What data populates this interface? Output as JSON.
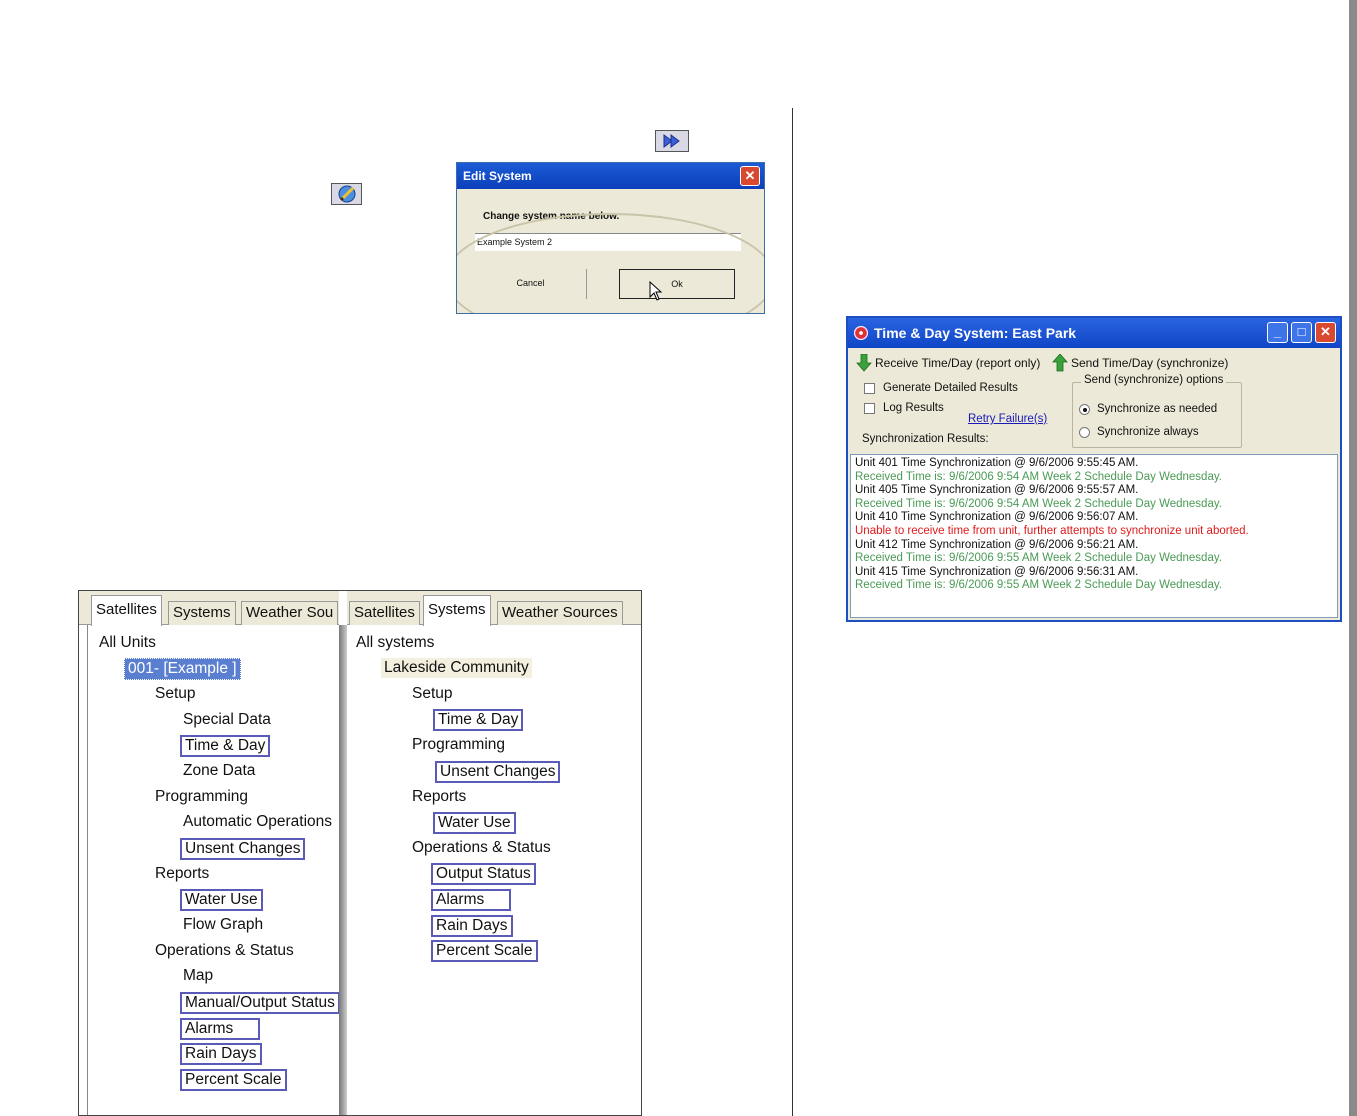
{
  "edit_system": {
    "title": "Edit System",
    "prompt": "Change system name below.",
    "name_value": "Example System 2",
    "cancel_label": "Cancel",
    "ok_label": "Ok"
  },
  "satellites_panel": {
    "tabs": [
      "Satellites",
      "Systems",
      "Weather Sou"
    ],
    "root": "All Units",
    "unit": "001- [Example ]",
    "nodes": [
      "Setup",
      "Special Data",
      "Time & Day",
      "Zone Data",
      "Programming",
      "Automatic Operations",
      "Unsent Changes",
      "Reports",
      "Water Use",
      "Flow Graph",
      "Operations & Status",
      "Map",
      "Manual/Output Status",
      "Alarms",
      "Rain Days",
      "Percent Scale"
    ]
  },
  "systems_panel": {
    "tabs": [
      "Satellites",
      "Systems",
      "Weather Sources"
    ],
    "root": "All systems",
    "system": "Lakeside Community",
    "nodes": [
      "Setup",
      "Time & Day",
      "Programming",
      "Unsent Changes",
      "Reports",
      "Water Use",
      "Operations & Status",
      "Output Status",
      "Alarms",
      "Rain Days",
      "Percent Scale"
    ]
  },
  "time_day": {
    "title": "Time & Day System: East Park",
    "receive_label": "Receive Time/Day  (report only)",
    "send_label": "Send Time/Day (synchronize)",
    "generate_label": "Generate Detailed Results",
    "log_label": "Log Results",
    "retry_label": "Retry Failure(s)",
    "options_legend": "Send (synchronize) options",
    "sync_needed_label": "Synchronize as needed",
    "sync_always_label": "Synchronize always",
    "results_label": "Synchronization Results:",
    "selected_option": "Synchronize as needed",
    "log": [
      "Unit 401 Time Synchronization @ 9/6/2006 9:55:45 AM.",
      "Received Time is: 9/6/2006 9:54 AM Week 2 Schedule Day Wednesday.",
      "Unit 405 Time Synchronization @ 9/6/2006 9:55:57 AM.",
      "Received Time is: 9/6/2006 9:54 AM Week 2 Schedule Day Wednesday.",
      "Unit 410 Time Synchronization @ 9/6/2006 9:56:07 AM.",
      "Unable to receive time from unit, further attempts to synchronize unit aborted.",
      "Unit 412 Time Synchronization @ 9/6/2006 9:56:21 AM.",
      "Received Time is: 9/6/2006 9:55 AM Week 2 Schedule Day Wednesday.",
      "Unit 415 Time Synchronization @ 9/6/2006 9:56:31 AM.",
      "Received Time is: 9/6/2006 9:55 AM Week 2 Schedule Day Wednesday."
    ]
  },
  "colors": {
    "accent_blue": "#1d5bd6",
    "success_green": "#4a9a55",
    "error_red": "#e01a1a",
    "highlight_box": "#5a5ab8"
  },
  "icons": [
    "fast-forward-icon",
    "edit-system-icon",
    "close-icon",
    "receive-arrow-icon",
    "send-arrow-icon",
    "minimize-icon",
    "maximize-icon"
  ]
}
